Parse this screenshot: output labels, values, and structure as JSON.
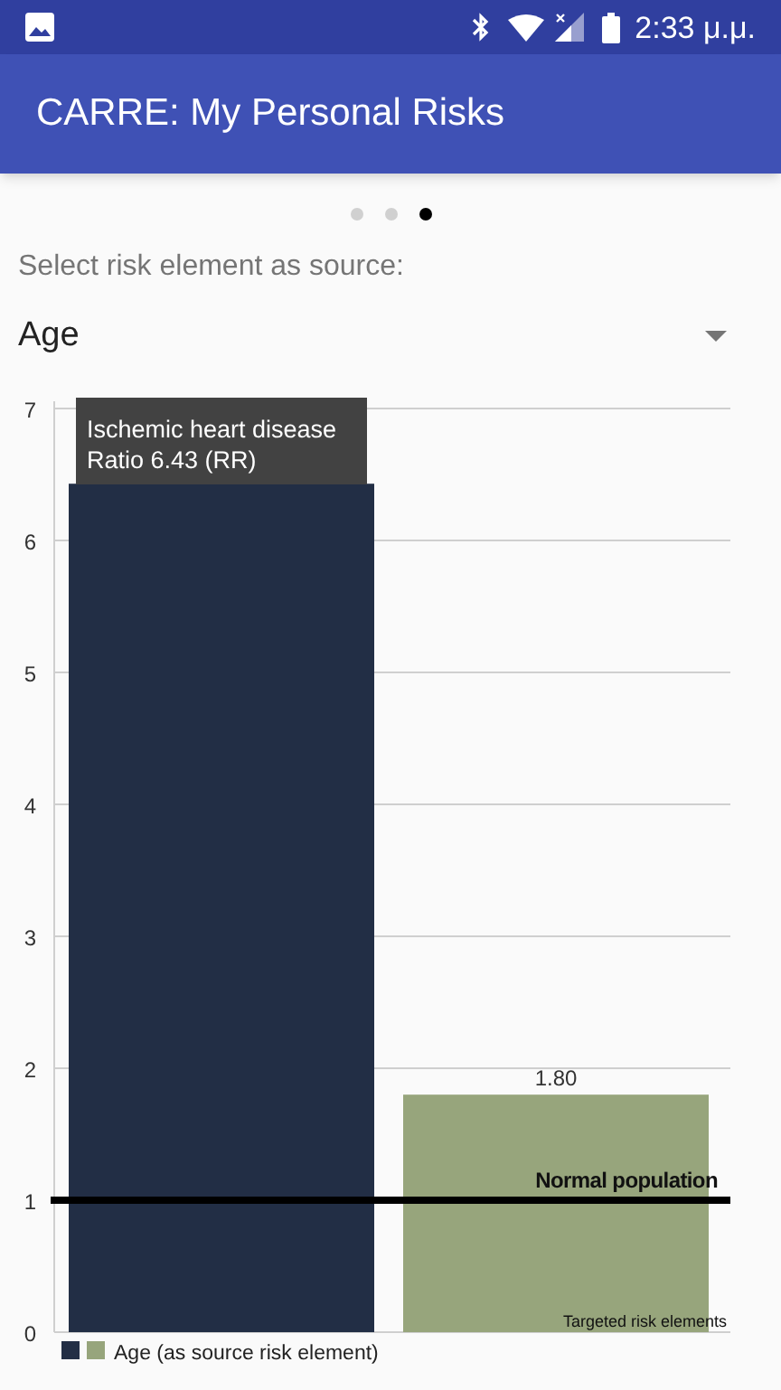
{
  "status_bar": {
    "time": "2:33 μ.μ."
  },
  "app_bar": {
    "title": "CARRE: My Personal Risks"
  },
  "pager": {
    "pages": [
      {
        "selected": false
      },
      {
        "selected": false
      },
      {
        "selected": true
      }
    ]
  },
  "source_label": "Select risk element as source:",
  "source_select": {
    "value": "Age"
  },
  "chart": {
    "chart_data": {
      "type": "bar",
      "xlabel": "Targeted risk elements",
      "ylim": [
        0,
        7
      ],
      "yticks": [
        0,
        1,
        2,
        3,
        4,
        5,
        6,
        7
      ],
      "grid": true,
      "series": [
        {
          "name": "Age (as source risk element)",
          "colors": [
            "#222e45",
            "#97a57c"
          ],
          "values": [
            6.43,
            1.8
          ]
        }
      ],
      "value_labels": [
        null,
        "1.80"
      ],
      "ref_lines": [
        {
          "axis": "y",
          "value": 1,
          "label": "Normal population"
        }
      ],
      "annotations": [
        "Ischemic heart disease",
        "Ratio 6.43 (RR)"
      ]
    }
  }
}
